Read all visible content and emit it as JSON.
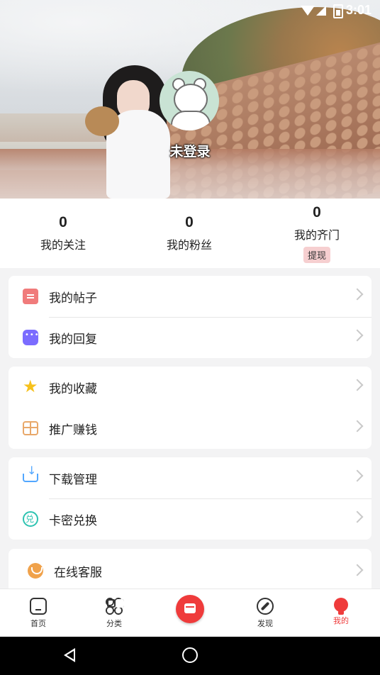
{
  "status_bar": {
    "time": "3:01"
  },
  "profile": {
    "login_text": "未登录"
  },
  "stats": [
    {
      "value": "0",
      "label": "我的关注"
    },
    {
      "value": "0",
      "label": "我的粉丝"
    },
    {
      "value": "0",
      "label": "我的齐门",
      "action": "提现"
    }
  ],
  "menu": {
    "group1": [
      {
        "label": "我的帖子",
        "icon": "post-icon"
      },
      {
        "label": "我的回复",
        "icon": "reply-icon"
      }
    ],
    "group2": [
      {
        "label": "我的收藏",
        "icon": "star-icon"
      },
      {
        "label": "推广赚钱",
        "icon": "gift-icon"
      }
    ],
    "group3": [
      {
        "label": "下载管理",
        "icon": "download-icon"
      },
      {
        "label": "卡密兑换",
        "icon": "redeem-icon"
      }
    ],
    "group4": [
      {
        "label": "在线客服",
        "icon": "customer-service-icon"
      }
    ]
  },
  "tabbar": {
    "home": "首页",
    "category": "分类",
    "discover": "发现",
    "me": "我的"
  },
  "colors": {
    "accent": "#ef3b3b",
    "background": "#f3f3f4"
  }
}
